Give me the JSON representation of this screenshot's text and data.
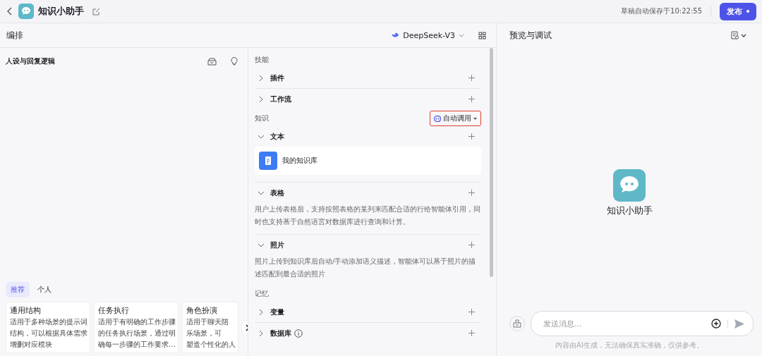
{
  "topbar": {
    "app_name": "知识小助手",
    "save_status": "草稿自动保存于10:22:55",
    "publish_button": "发布"
  },
  "editor": {
    "title": "编排",
    "model": "DeepSeek-V3"
  },
  "prompt_panel": {
    "title": "人设与回复逻辑",
    "template_tabs": [
      {
        "label": "推荐",
        "selected": true
      },
      {
        "label": "个人",
        "selected": false
      }
    ],
    "templates": [
      {
        "title": "通用结构",
        "lines": [
          "适用于多种场景的提示词",
          "结构，可以根据具体需求",
          "增删对应模块"
        ]
      },
      {
        "title": "任务执行",
        "lines": [
          "适用于有明确的工作步骤",
          "的任务执行场景，通过明",
          "确每一步骤的工作要求…"
        ]
      },
      {
        "title": "角色扮演",
        "lines": [
          "适用于聊天陪",
          "乐场景，可",
          "塑造个性化的人"
        ]
      }
    ]
  },
  "sections": [
    {
      "title": "技能",
      "items": [
        {
          "kind": "row",
          "label": "插件",
          "expanded": false
        },
        {
          "kind": "row",
          "label": "工作流",
          "expanded": false
        }
      ]
    },
    {
      "title": "知识",
      "mode_button": {
        "label": "自动调用",
        "highlighted": true
      },
      "items": [
        {
          "kind": "row",
          "label": "文本",
          "expanded": true,
          "entries": [
            "我的知识库"
          ]
        },
        {
          "kind": "row",
          "label": "表格",
          "expanded": true,
          "description": "用户上传表格后，支持按照表格的某列来匹配合适的行给智能体引用，同时也支持基于自然语言对数据库进行查询和计算。"
        },
        {
          "kind": "row",
          "label": "照片",
          "expanded": true,
          "description": "照片上传到知识库后自动/手动添加语义描述，智能体可以基于照片的描述匹配到最合适的照片"
        }
      ]
    },
    {
      "title": "记忆",
      "items": [
        {
          "kind": "row",
          "label": "变量",
          "expanded": false
        },
        {
          "kind": "row",
          "label": "数据库",
          "expanded": false,
          "info": true
        }
      ]
    }
  ],
  "preview": {
    "title": "预览与调试",
    "bot_name": "知识小助手",
    "input": {
      "placeholder": "发送消息..."
    },
    "disclaimer": "内容由AI生成，无法确保真实准确，仅供参考。"
  }
}
